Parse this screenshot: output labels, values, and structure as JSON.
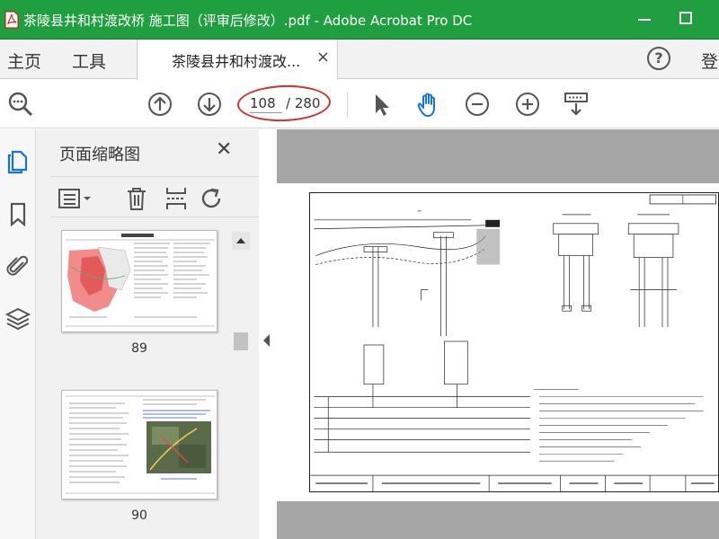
{
  "window": {
    "title": "茶陵县井和村渡改桥 施工图（评审后修改）.pdf - Adobe Acrobat Pro DC"
  },
  "tabs": {
    "home_label": "主页",
    "tools_label": "工具",
    "document_tab_label": "茶陵县井和村渡改...",
    "close_symbol": "×",
    "help_symbol": "?",
    "login_label": "登"
  },
  "toolbar": {
    "current_page": "108",
    "total_pages": "/ 280"
  },
  "panel": {
    "title": "页面缩略图",
    "close_symbol": "✕",
    "thumbnails": [
      {
        "page_label": "89"
      },
      {
        "page_label": "90"
      }
    ]
  },
  "colors": {
    "title_bar": "#1f9f3f",
    "hand_tool_active": "#1473e6",
    "annotation_ellipse": "#d2322d"
  },
  "icons": [
    "pdf-icon",
    "zoom-search-icon",
    "page-up-icon",
    "page-down-icon",
    "select-arrow-icon",
    "hand-icon",
    "zoom-out-icon",
    "zoom-in-icon",
    "scroll-mode-icon",
    "pages-icon",
    "bookmark-icon",
    "attachment-icon",
    "layers-icon",
    "options-menu-icon",
    "trash-icon",
    "insert-page-icon",
    "rotate-icon"
  ]
}
